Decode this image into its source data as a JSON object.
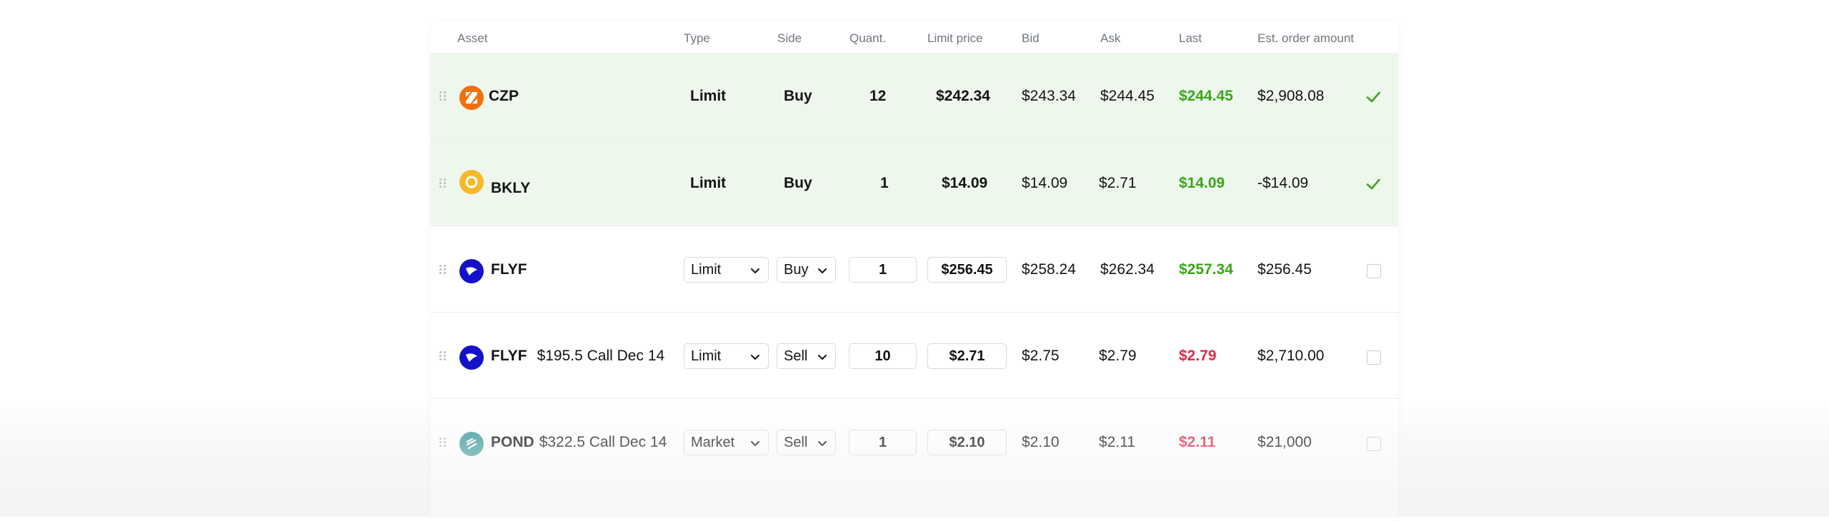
{
  "table": {
    "headers": {
      "asset": "Asset",
      "type": "Type",
      "side": "Side",
      "quant": "Quant.",
      "limit_price": "Limit price",
      "bid": "Bid",
      "ask": "Ask",
      "last": "Last",
      "est_amount": "Est. order amount"
    },
    "rows": [
      {
        "ticker": "CZP",
        "option": "",
        "type": "Limit",
        "side": "Buy",
        "quantity": "12",
        "limit_price": "$242.34",
        "bid": "$243.34",
        "ask": "$244.45",
        "last": "$244.45",
        "last_color": "green",
        "est_amount": "$2,908.08",
        "status": "confirmed"
      },
      {
        "ticker": "BKLY",
        "option": "",
        "type": "Limit",
        "side": "Buy",
        "quantity": "1",
        "limit_price": "$14.09",
        "bid": "$14.09",
        "ask": "$2.71",
        "last": "$14.09",
        "last_color": "green",
        "est_amount": "-$14.09",
        "status": "confirmed"
      },
      {
        "ticker": "FLYF",
        "option": "",
        "type": "Limit",
        "side": "Buy",
        "quantity": "1",
        "limit_price": "$256.45",
        "bid": "$258.24",
        "ask": "$262.34",
        "last": "$257.34",
        "last_color": "green",
        "est_amount": "$256.45",
        "status": "editable"
      },
      {
        "ticker": "FLYF",
        "option": "$195.5 Call Dec 14",
        "type": "Limit",
        "side": "Sell",
        "quantity": "10",
        "limit_price": "$2.71",
        "bid": "$2.75",
        "ask": "$2.79",
        "last": "$2.79",
        "last_color": "red",
        "est_amount": "$2,710.00",
        "status": "editable"
      },
      {
        "ticker": "POND",
        "option": "$322.5 Call Dec 14",
        "type": "Market",
        "side": "Sell",
        "quantity": "1",
        "limit_price": "$2.10",
        "bid": "$2.10",
        "ask": "$2.11",
        "last": "$2.11",
        "last_color": "red",
        "est_amount": "$21,000",
        "status": "editable"
      }
    ]
  },
  "icons": {
    "CZP": "czp-logo-icon",
    "BKLY": "bkly-logo-icon",
    "FLYF": "flyf-logo-icon",
    "POND": "pond-logo-icon"
  },
  "colors": {
    "confirmed_row_bg": "#eef7ec",
    "green": "#3aa619",
    "red": "#e0284a",
    "czp": "#f26f0e",
    "bkly": "#f7b82a",
    "flyf": "#1511c9",
    "pond": "#3f9a9e"
  }
}
